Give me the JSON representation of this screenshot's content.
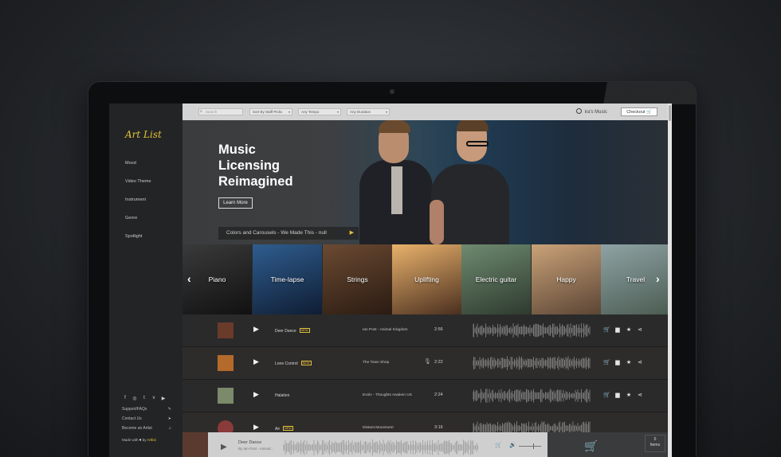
{
  "sidebar": {
    "logo": "Art List",
    "nav": [
      "Mood",
      "Video Theme",
      "Instrument",
      "Genre",
      "Spotlight"
    ],
    "social": [
      "f",
      "◎",
      "t",
      "v",
      "▶"
    ],
    "footer_links": [
      {
        "label": "Support/FAQs",
        "icon": "✎"
      },
      {
        "label": "Contact Us",
        "icon": "➤"
      },
      {
        "label": "Become an Artist",
        "icon": "♫"
      }
    ],
    "made_with": "Made with",
    "made_by": "by",
    "made_brand": "Artlist"
  },
  "topbar": {
    "search_placeholder": "Search",
    "filters": [
      "Sort By Staff Picks",
      "Any Tempo",
      "Any Duration"
    ],
    "user_name": "ira's Music",
    "checkout_label": "Checkout 🛒"
  },
  "hero": {
    "title": "Music Licensing Reimagined",
    "learn_more": "Learn More",
    "now_playing": "Colors and Carousels - We Made This - null"
  },
  "carousel": {
    "tiles": [
      {
        "label": "Piano",
        "c1": "#3a3a3a",
        "c2": "#111111"
      },
      {
        "label": "Time-lapse",
        "c1": "#2f5d8f",
        "c2": "#0f1d33"
      },
      {
        "label": "Strings",
        "c1": "#6b4a32",
        "c2": "#2a1b12"
      },
      {
        "label": "Uplifting",
        "c1": "#e9b26c",
        "c2": "#4a2f1f"
      },
      {
        "label": "Electric guitar",
        "c1": "#6e8a70",
        "c2": "#2e3a2e"
      },
      {
        "label": "Happy",
        "c1": "#caa278",
        "c2": "#5b4535"
      },
      {
        "label": "Travel",
        "c1": "#8fa3a5",
        "c2": "#4b5c52"
      }
    ]
  },
  "tracks": [
    {
      "title": "Deer Dance",
      "is_new": true,
      "artist": "Ian Post - Animal Kingdom",
      "duration": "2:56",
      "vocal": false,
      "in_cart": false,
      "thumb": "#6a3a2a"
    },
    {
      "title": "Lone Control",
      "is_new": true,
      "artist": "The Town Shop",
      "duration": "2:22",
      "vocal": true,
      "in_cart": false,
      "thumb": "#b46a2a"
    },
    {
      "title": "Halation",
      "is_new": false,
      "artist": "Evolv - Thoughts Awaken US",
      "duration": "2:24",
      "vocal": false,
      "in_cart": true,
      "thumb": "#7a8a6a"
    },
    {
      "title": "Air",
      "is_new": true,
      "artist": "Distant Movement",
      "duration": "3:16",
      "vocal": false,
      "in_cart": false,
      "thumb": "#8a3a3a"
    }
  ],
  "new_badge": "NEW",
  "player": {
    "title": "Deer Dance",
    "subtitle": "By Ian Post - Animal...",
    "items_count": "0",
    "items_label": "Items"
  },
  "icons": {
    "cart": "🛒",
    "folder": "▆",
    "star": "★",
    "share": "⋖"
  }
}
